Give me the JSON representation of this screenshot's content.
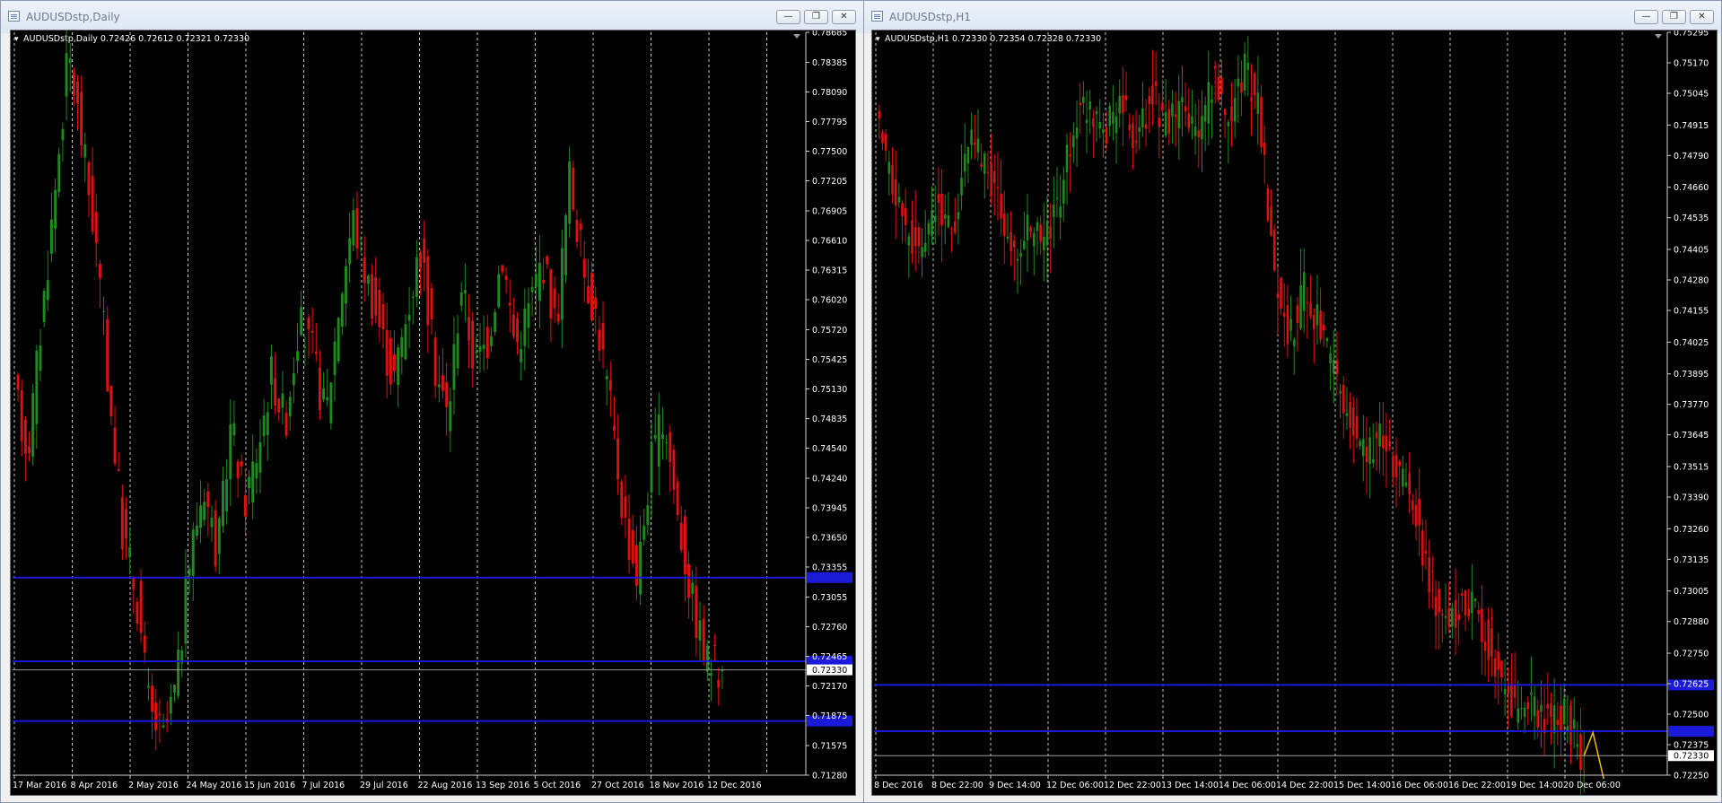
{
  "desktop": {
    "background": "#d6dbe9"
  },
  "left_window": {
    "title": "AUDUSDstp,Daily",
    "header": "AUDUSDstp,Daily  0.72426 0.72612 0.72321 0.72330",
    "buttons": [
      "minimize-icon",
      "restore-icon",
      "close-icon"
    ]
  },
  "right_window": {
    "title": "AUDUSDstp,H1",
    "header": "AUDUSDstp,H1  0.72330 0.72354 0.72328 0.72330",
    "buttons": [
      "minimize-icon",
      "restore-icon",
      "close-icon"
    ]
  },
  "colors": {
    "bull": "#1f8a1f",
    "bear": "#e01010",
    "grid": "#c8c8c8",
    "hline": "#1a1ad8",
    "label_fill": "#1a1ad8"
  },
  "chart_data": [
    {
      "type": "candlestick",
      "title": "AUDUSDstp,Daily",
      "ohlc_header": [
        0.72426,
        0.72612,
        0.72321,
        0.7233
      ],
      "ylim": [
        0.7128,
        0.78685
      ],
      "y_ticks": [
        "0.78685",
        "0.78385",
        "0.78090",
        "0.77795",
        "0.77500",
        "0.77205",
        "0.76905",
        "0.76610",
        "0.76315",
        "0.76020",
        "0.75720",
        "0.75425",
        "0.75130",
        "0.74835",
        "0.74540",
        "0.74240",
        "0.73945",
        "0.73650",
        "0.73355",
        "0.73055",
        "0.72760",
        "0.72465",
        "0.72170",
        "0.71875",
        "0.71575",
        "0.71280"
      ],
      "x_labels": [
        "17 Mar 2016",
        "8 Apr 2016",
        "2 May 2016",
        "24 May 2016",
        "15 Jun 2016",
        "7 Jul 2016",
        "29 Jul 2016",
        "22 Aug 2016",
        "13 Sep 2016",
        "5 Oct 2016",
        "27 Oct 2016",
        "18 Nov 2016",
        "12 Dec 2016"
      ],
      "horizontal_lines": [
        0.7325,
        0.72415,
        0.7182
      ],
      "current_price": "0.72330",
      "price_path": [
        0.751,
        0.745,
        0.758,
        0.771,
        0.785,
        0.776,
        0.766,
        0.751,
        0.737,
        0.731,
        0.719,
        0.7165,
        0.722,
        0.735,
        0.742,
        0.7345,
        0.748,
        0.74,
        0.7455,
        0.753,
        0.748,
        0.758,
        0.755,
        0.7485,
        0.76,
        0.7685,
        0.7625,
        0.7575,
        0.752,
        0.759,
        0.7655,
        0.754,
        0.7485,
        0.762,
        0.7535,
        0.7565,
        0.765,
        0.7555,
        0.7595,
        0.7645,
        0.7575,
        0.7725,
        0.7635,
        0.7585,
        0.7495,
        0.7385,
        0.7325,
        0.744,
        0.7485,
        0.7385,
        0.7305,
        0.7245,
        0.7233
      ]
    },
    {
      "type": "candlestick",
      "title": "AUDUSDstp,H1",
      "ohlc_header": [
        0.7233,
        0.72354,
        0.72328,
        0.7233
      ],
      "ylim": [
        0.7225,
        0.75295
      ],
      "y_ticks": [
        "0.75295",
        "0.75170",
        "0.75045",
        "0.74915",
        "0.74790",
        "0.74660",
        "0.74535",
        "0.74405",
        "0.74280",
        "0.74155",
        "0.74025",
        "0.73895",
        "0.73770",
        "0.73645",
        "0.73515",
        "0.73390",
        "0.73260",
        "0.73135",
        "0.73005",
        "0.72880",
        "0.72750",
        "0.72625",
        "0.72500",
        "0.72375",
        "0.72250"
      ],
      "x_labels": [
        "8 Dec 2016",
        "8 Dec 22:00",
        "9 Dec 14:00",
        "12 Dec 06:00",
        "12 Dec 22:00",
        "13 Dec 14:00",
        "14 Dec 06:00",
        "14 Dec 22:00",
        "15 Dec 14:00",
        "16 Dec 06:00",
        "16 Dec 22:00",
        "19 Dec 14:00",
        "20 Dec 06:00"
      ],
      "horizontal_lines": [
        0.7262,
        0.7243
      ],
      "current_price": "0.72330",
      "price_path": [
        0.7492,
        0.7468,
        0.7448,
        0.744,
        0.746,
        0.7445,
        0.7485,
        0.7478,
        0.746,
        0.7435,
        0.745,
        0.7442,
        0.7462,
        0.7495,
        0.75,
        0.749,
        0.7502,
        0.7482,
        0.7505,
        0.749,
        0.7498,
        0.7485,
        0.751,
        0.7495,
        0.7515,
        0.7498,
        0.743,
        0.7405,
        0.7425,
        0.7408,
        0.7385,
        0.737,
        0.7358,
        0.7362,
        0.7352,
        0.734,
        0.7308,
        0.7288,
        0.7292,
        0.7297,
        0.7278,
        0.7262,
        0.725,
        0.7252,
        0.7248,
        0.725,
        0.7233
      ]
    }
  ]
}
